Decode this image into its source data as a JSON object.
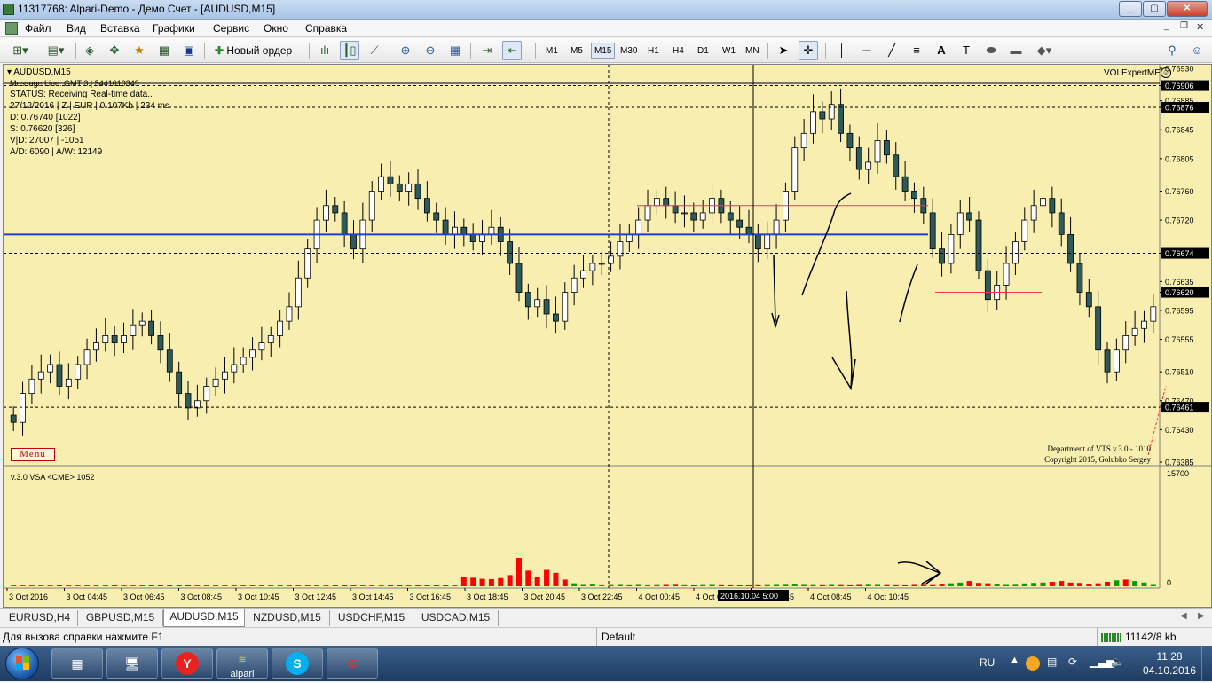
{
  "window": {
    "title": "11317768: Alpari-Demo - Демо Счет - [AUDUSD,M15]"
  },
  "menu": [
    "Файл",
    "Вид",
    "Вставка",
    "Графики",
    "Сервис",
    "Окно",
    "Справка"
  ],
  "toolbar": {
    "new_order_label": "Новый ордер",
    "timeframes": [
      "M1",
      "M5",
      "M15",
      "M30",
      "H1",
      "H4",
      "D1",
      "W1",
      "MN"
    ],
    "active_timeframe": "M15"
  },
  "chart": {
    "symbol_label": "AUDUSD,M15",
    "expert_label": "VOLExpertME",
    "info": [
      "Message Line: GMT 3 | 5441010349",
      "STATUS:  Receiving Real-time data..",
      "27/12/2016 | Z | EUR | 0.107Kb | 234 ms",
      "D: 0.76740  [1022]",
      "S: 0.76620  [326]",
      "V|D: 27007 | -1051",
      "A/D: 6090 | A/W: 12149"
    ],
    "menu_button": "Menu",
    "credits": [
      "Department of VTS  v.3.0 - 1010",
      "Copyright 2015, Golubko Sergey"
    ],
    "indicator_label": "v.3.0 VSA <CME> 1052",
    "volume_scale": [
      "15700",
      "0"
    ],
    "crosshair_time": "2016.10.04 5:00",
    "colors": {
      "background": "#f7eeb0",
      "bull_candle": "#ffffff",
      "bear_candle": "#2f5a5a",
      "volume_green": "#00a000",
      "volume_red": "#ff0000",
      "volume_magenta": "#ff00ff",
      "blue_level": "#2040d0",
      "red_level": "#ff3060"
    }
  },
  "chart_data": {
    "type": "candlestick",
    "symbol": "AUDUSD",
    "timeframe": "M15",
    "price_axis": [
      "0.76930",
      "0.76906",
      "0.76885",
      "0.76876",
      "0.76845",
      "0.76805",
      "0.76760",
      "0.76720",
      "0.76674",
      "0.76635",
      "0.76620",
      "0.76595",
      "0.76555",
      "0.76510",
      "0.76470",
      "0.76461",
      "0.76430",
      "0.76385"
    ],
    "highlighted_prices": [
      "0.76906",
      "0.76876",
      "0.76674",
      "0.76620",
      "0.76461"
    ],
    "ylim": [
      0.76385,
      0.7693
    ],
    "time_axis": [
      "3 Oct 2016",
      "3 Oct 04:45",
      "3 Oct 06:45",
      "3 Oct 08:45",
      "3 Oct 10:45",
      "3 Oct 12:45",
      "3 Oct 14:45",
      "3 Oct 16:45",
      "3 Oct 18:45",
      "3 Oct 20:45",
      "3 Oct 22:45",
      "4 Oct 00:45",
      "4 Oct 02",
      "4 Oct 06:45",
      "4 Oct 08:45",
      "4 Oct 10:45"
    ],
    "levels": {
      "dotted": [
        0.76906,
        0.76876,
        0.76674,
        0.76461
      ],
      "blue": 0.767,
      "red": [
        0.7674,
        0.7662
      ]
    },
    "closes": [
      0.7644,
      0.7648,
      0.765,
      0.7651,
      0.7652,
      0.7649,
      0.765,
      0.7652,
      0.7654,
      0.7655,
      0.7656,
      0.7655,
      0.7656,
      0.76575,
      0.7658,
      0.7656,
      0.7654,
      0.7651,
      0.7648,
      0.7646,
      0.7647,
      0.7649,
      0.765,
      0.7651,
      0.7652,
      0.7653,
      0.7654,
      0.7655,
      0.7656,
      0.7658,
      0.766,
      0.7664,
      0.7668,
      0.7672,
      0.7674,
      0.7673,
      0.767,
      0.7668,
      0.7672,
      0.7676,
      0.7678,
      0.7677,
      0.7676,
      0.7677,
      0.7675,
      0.7673,
      0.7672,
      0.767,
      0.7671,
      0.767,
      0.7669,
      0.767,
      0.7671,
      0.7669,
      0.7666,
      0.7662,
      0.766,
      0.7661,
      0.7659,
      0.7658,
      0.7662,
      0.7664,
      0.7665,
      0.7666,
      0.7666,
      0.7667,
      0.7669,
      0.767,
      0.7672,
      0.7674,
      0.7675,
      0.7674,
      0.7673,
      0.7673,
      0.7672,
      0.7673,
      0.7675,
      0.7673,
      0.7672,
      0.7671,
      0.767,
      0.7668,
      0.767,
      0.7672,
      0.7676,
      0.7682,
      0.7684,
      0.7687,
      0.7686,
      0.7688,
      0.7684,
      0.7682,
      0.7679,
      0.768,
      0.7683,
      0.7681,
      0.7678,
      0.7676,
      0.7675,
      0.7673,
      0.7668,
      0.7666,
      0.767,
      0.7673,
      0.7672,
      0.7665,
      0.7661,
      0.7663,
      0.7666,
      0.7669,
      0.7672,
      0.7674,
      0.7675,
      0.7673,
      0.767,
      0.7666,
      0.7662,
      0.766,
      0.7654,
      0.7651,
      0.7654,
      0.7656,
      0.7657,
      0.7658,
      0.766
    ],
    "volume": [
      120,
      180,
      150,
      200,
      160,
      140,
      170,
      190,
      150,
      130,
      160,
      180,
      170,
      210,
      190,
      160,
      150,
      140,
      170,
      180,
      160,
      150,
      140,
      160,
      220,
      190,
      170,
      150,
      160,
      180,
      200,
      210,
      190,
      180,
      170,
      160,
      150,
      170,
      190,
      200,
      180,
      160,
      150,
      170,
      160,
      150,
      140,
      160,
      170,
      1200,
      1150,
      1000,
      950,
      1100,
      1500,
      3800,
      2100,
      1200,
      2200,
      1800,
      900,
      400,
      300,
      350,
      250,
      280,
      300,
      260,
      300,
      250,
      280,
      300,
      320,
      260,
      240,
      280,
      300,
      260,
      250,
      220,
      240,
      260,
      280,
      300,
      320,
      350,
      300,
      280,
      260,
      300,
      280,
      250,
      300,
      320,
      300,
      280,
      260,
      250,
      300,
      320,
      280,
      350,
      400,
      500,
      700,
      450,
      400,
      350,
      300,
      320,
      380,
      450,
      500,
      600,
      700,
      500,
      450,
      350,
      400,
      600,
      800,
      900,
      700,
      500,
      300
    ]
  },
  "tabs": [
    "EURUSD,H4",
    "GBPUSD,M15",
    "AUDUSD,M15",
    "NZDUSD,M15",
    "USDCHF,M15",
    "USDCAD,M15"
  ],
  "active_tab": "AUDUSD,M15",
  "status": {
    "help_text": "Для вызова справки нажмите F1",
    "profile": "Default",
    "traffic": "11142/8 kb"
  },
  "taskbar": {
    "apps": [
      "start-button",
      "calculator",
      "computer",
      "yandex",
      "alpari",
      "skype",
      "app"
    ],
    "alpari_label": "alpari",
    "lang": "RU",
    "time": "11:28",
    "date": "04.10.2016"
  }
}
